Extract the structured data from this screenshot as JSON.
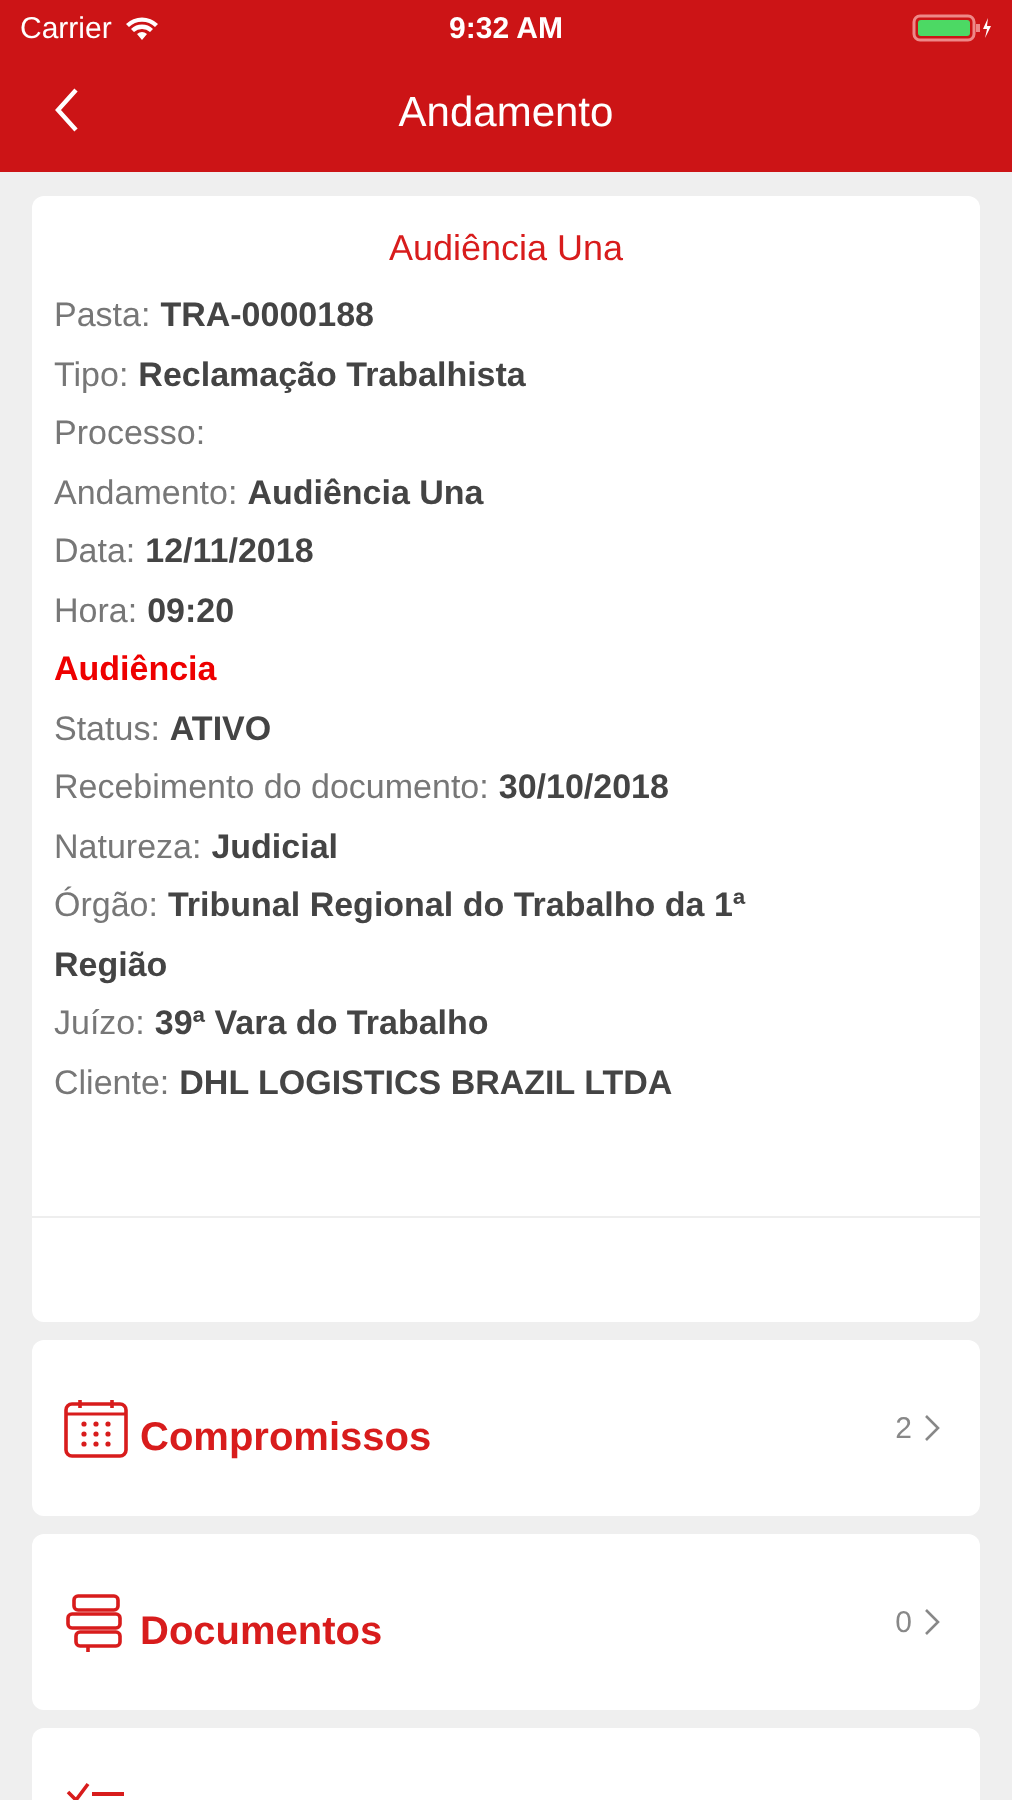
{
  "status_bar": {
    "carrier": "Carrier",
    "time": "9:32 AM"
  },
  "nav": {
    "title": "Andamento"
  },
  "detail": {
    "title": "Audiência Una",
    "rows": [
      {
        "kind": "field",
        "label": "Pasta:",
        "value": "TRA-0000188"
      },
      {
        "kind": "field",
        "label": "Tipo:",
        "value": "Reclamação Trabalhista"
      },
      {
        "kind": "field",
        "label": "Processo:"
      },
      {
        "kind": "field",
        "label": "Andamento:",
        "value": "Audiência Una"
      },
      {
        "kind": "field",
        "label": "Data:",
        "value": "12/11/2018"
      },
      {
        "kind": "field",
        "label": "Hora:",
        "value": "09:20"
      },
      {
        "kind": "section",
        "label": "Audiência"
      },
      {
        "kind": "field",
        "label": "Status:",
        "value": "ATIVO"
      },
      {
        "kind": "field",
        "label": "Recebimento do documento:",
        "value": "30/10/2018"
      },
      {
        "kind": "field",
        "label": "Natureza:",
        "value": "Judicial"
      },
      {
        "kind": "field",
        "label": "Órgão:",
        "value": "Tribunal Regional do Trabalho da 1ª Região"
      },
      {
        "kind": "field",
        "label": "Juízo:",
        "value": "39ª Vara do Trabalho"
      },
      {
        "kind": "field",
        "label": "Cliente:",
        "value": "DHL LOGISTICS BRAZIL LTDA"
      }
    ]
  },
  "links": [
    {
      "kind": "calendar",
      "label": "Compromissos",
      "count": "2"
    },
    {
      "kind": "books",
      "label": "Documentos",
      "count": "0"
    },
    {
      "kind": "checklist"
    }
  ]
}
